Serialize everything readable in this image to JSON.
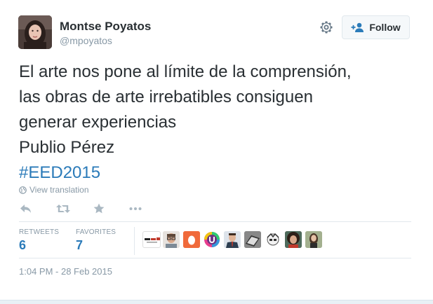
{
  "user": {
    "name": "Montse Poyatos",
    "handle": "@mpoyatos"
  },
  "follow_button": {
    "label": "Follow",
    "icon": "add-user-icon"
  },
  "settings_icon": "gear-icon",
  "tweet": {
    "lines": [
      "El arte nos pone al límite de la comprensión,",
      "las obras de arte irrebatibles consiguen",
      "generar experiencias",
      "Publio Pérez"
    ],
    "hashtag": "#EED2015"
  },
  "view_translation": "View translation",
  "actions": [
    "reply-icon",
    "retweet-icon",
    "favorite-star-icon",
    "more-icon"
  ],
  "stats": {
    "retweets_label": "RETWEETS",
    "retweets_count": "6",
    "favorites_label": "FAVORITES",
    "favorites_count": "7"
  },
  "favoriters": [
    "eed-logo-avatar",
    "man-glasses-avatar",
    "egg-avatar",
    "u-logo-avatar",
    "man-suit-avatar",
    "laptop-avatar",
    "cartoon-avatar",
    "curly-hair-avatar",
    "woman-avatar"
  ],
  "timestamp": "1:04 PM - 28 Feb 2015",
  "colors": {
    "link_blue": "#2b7bb9",
    "text": "#292f33",
    "muted": "#8899a6",
    "border": "#e1e8ed"
  }
}
